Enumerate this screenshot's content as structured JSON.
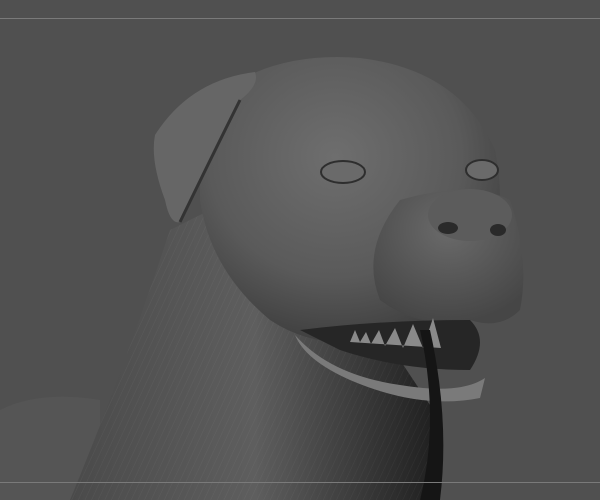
{
  "viewport": {
    "background_color": "#505050",
    "guide_line_color": "#7a7a7a",
    "model_base_color": "#5e5e5e",
    "model_highlight_color": "#8a8a8a",
    "model_shadow_color": "#262626"
  }
}
